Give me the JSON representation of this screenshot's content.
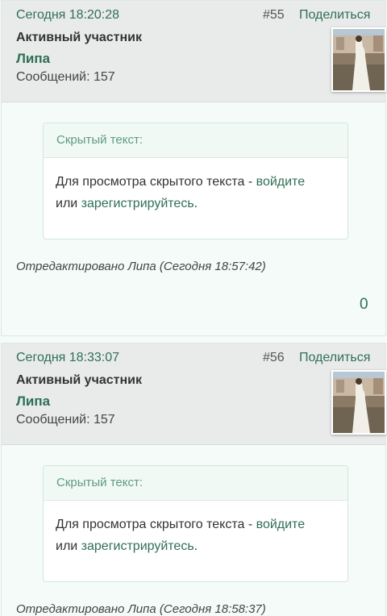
{
  "posts": [
    {
      "date": "Сегодня 18:20:28",
      "number": "#55",
      "share_label": "Поделиться",
      "role": "Активный участник",
      "author": "Липа",
      "message_count": "Сообщений: 157",
      "hidden_header": "Скрытый текст:",
      "hidden_text_before": "Для просмотра скрытого текста - ",
      "login_link": "войдите",
      "hidden_text_middle": " или ",
      "register_link": "зарегистрируйтесь",
      "hidden_text_after": ".",
      "edited": "Отредактировано Липа (Сегодня 18:57:42)",
      "reaction_count": "0"
    },
    {
      "date": "Сегодня 18:33:07",
      "number": "#56",
      "share_label": "Поделиться",
      "role": "Активный участник",
      "author": "Липа",
      "message_count": "Сообщений: 157",
      "hidden_header": "Скрытый текст:",
      "hidden_text_before": "Для просмотра скрытого текста - ",
      "login_link": "войдите",
      "hidden_text_middle": " или ",
      "register_link": "зарегистрируйтесь",
      "hidden_text_after": ".",
      "edited": "Отредактировано Липа (Сегодня 18:58:37)"
    }
  ],
  "colors": {
    "accent": "#2f6f55",
    "header_bg": "#e9ebea",
    "page_bg": "#f4fbf8"
  }
}
